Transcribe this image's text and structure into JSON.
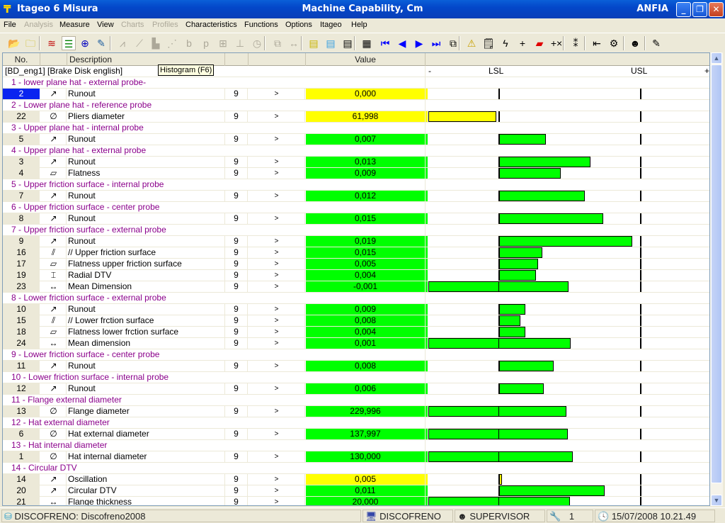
{
  "window": {
    "app_title": "Itageo 6 Misura",
    "doc_title": "Machine Capability, Cm",
    "company": "ANFIA",
    "buttons": {
      "minimize": "_",
      "restore": "❐",
      "close": "✕"
    }
  },
  "menu": [
    {
      "label": "File",
      "enabled": true
    },
    {
      "label": "Analysis",
      "enabled": false
    },
    {
      "label": "Measure",
      "enabled": true
    },
    {
      "label": "View",
      "enabled": true
    },
    {
      "label": "Charts",
      "enabled": false
    },
    {
      "label": "Profiles",
      "enabled": false
    },
    {
      "label": "Characteristics",
      "enabled": true
    },
    {
      "label": "Functions",
      "enabled": true
    },
    {
      "label": "Options",
      "enabled": true
    },
    {
      "label": "Itageo",
      "enabled": true
    },
    {
      "label": "Help",
      "enabled": true
    }
  ],
  "toolbar": [
    {
      "icon": "open-folder-icon",
      "glyph": "📂"
    },
    {
      "icon": "folder-icon",
      "glyph": "🗀"
    },
    {
      "icon": "chart-list-icon",
      "glyph": "≋"
    },
    {
      "icon": "histogram-view-icon",
      "glyph": "☰",
      "pressed": true
    },
    {
      "icon": "crosshair-icon",
      "glyph": "⊕"
    },
    {
      "icon": "pen-icon",
      "glyph": "✎"
    },
    {
      "icon": "run-chart-icon",
      "glyph": "⩘",
      "disabled": true
    },
    {
      "icon": "regression-icon",
      "glyph": "⟋",
      "disabled": true
    },
    {
      "icon": "bar-chart-icon",
      "glyph": "▙",
      "disabled": true
    },
    {
      "icon": "scatter-icon",
      "glyph": "⋰",
      "disabled": true
    },
    {
      "icon": "b-chart-icon",
      "glyph": "b",
      "disabled": true
    },
    {
      "icon": "p-chart-icon",
      "glyph": "p",
      "disabled": true
    },
    {
      "icon": "control-chart-icon",
      "glyph": "⊞",
      "disabled": true
    },
    {
      "icon": "boxplot-icon",
      "glyph": "⊥",
      "disabled": true
    },
    {
      "icon": "clock-chart-icon",
      "glyph": "◷",
      "disabled": true
    },
    {
      "icon": "copy-chart-icon",
      "glyph": "⧉",
      "disabled": true
    },
    {
      "icon": "range-icon",
      "glyph": "↔",
      "disabled": true
    },
    {
      "icon": "note-yellow-icon",
      "glyph": "▤"
    },
    {
      "icon": "note-blue-icon",
      "glyph": "▤"
    },
    {
      "icon": "note-white-icon",
      "glyph": "▤"
    },
    {
      "icon": "open-table-icon",
      "glyph": "▦"
    },
    {
      "icon": "first-record-icon",
      "glyph": "⏮"
    },
    {
      "icon": "previous-record-icon",
      "glyph": "◀"
    },
    {
      "icon": "next-record-icon",
      "glyph": "▶"
    },
    {
      "icon": "last-record-icon",
      "glyph": "⏭"
    },
    {
      "icon": "pages-icon",
      "glyph": "⧉"
    },
    {
      "icon": "warning-icon",
      "glyph": "⚠"
    },
    {
      "icon": "notepad-icon",
      "glyph": "🗒"
    },
    {
      "icon": "flash-list-icon",
      "glyph": "ϟ"
    },
    {
      "icon": "plus-cross-icon",
      "glyph": "+"
    },
    {
      "icon": "red-bookmark-icon",
      "glyph": "▰"
    },
    {
      "icon": "plus-times-icon",
      "glyph": "+×"
    },
    {
      "icon": "numbering-icon",
      "glyph": "⁑"
    },
    {
      "icon": "align-icon",
      "glyph": "⇤"
    },
    {
      "icon": "settings-tools-icon",
      "glyph": "⚙"
    },
    {
      "icon": "operator-icon",
      "glyph": "☻"
    },
    {
      "icon": "properties-icon",
      "glyph": "✎"
    }
  ],
  "tooltip": "Histogram (F6)",
  "grid": {
    "headers": {
      "no": "No.",
      "symbol": "",
      "description": "Description",
      "n": "",
      "op": "",
      "value": "Value"
    },
    "part_title": "[BD_eng1] [Brake Disk english]",
    "scale": {
      "minus": "-",
      "lsl": "LSL",
      "usl": "USL",
      "plus": "+"
    },
    "colors": {
      "ok": "#00ff00",
      "warning": "#ffff00",
      "selected": "#0a24f0",
      "group": "#8b008b"
    },
    "rows": [
      {
        "type": "group",
        "label": "1 - lower plane hat - external probe-"
      },
      {
        "type": "item",
        "no": "2",
        "symbol": "↗",
        "symbol_name": "runout-icon",
        "desc": "Runout",
        "n": "9",
        "op": ">",
        "value": "0,000",
        "status": "warning",
        "selected": true,
        "bar": null
      },
      {
        "type": "group",
        "label": "2 - Lower plane hat - reference probe"
      },
      {
        "type": "item",
        "no": "22",
        "symbol": "∅",
        "symbol_name": "diameter-icon",
        "desc": "Pliers diameter",
        "n": "9",
        "op": ">",
        "value": "61,998",
        "status": "warning",
        "bar": [
          -0.5,
          -0.02
        ]
      },
      {
        "type": "group",
        "label": "3 - Upper plane hat - internal probe"
      },
      {
        "type": "item",
        "no": "5",
        "symbol": "↗",
        "symbol_name": "runout-icon",
        "desc": "Runout",
        "n": "9",
        "op": ">",
        "value": "0,007",
        "status": "ok",
        "bar": [
          0,
          0.33
        ]
      },
      {
        "type": "group",
        "label": "4 - Upper plane hat - external probe"
      },
      {
        "type": "item",
        "no": "3",
        "symbol": "↗",
        "symbol_name": "runout-icon",
        "desc": "Runout",
        "n": "9",
        "op": ">",
        "value": "0,013",
        "status": "ok",
        "bar": [
          0,
          0.645
        ]
      },
      {
        "type": "item",
        "no": "4",
        "symbol": "▱",
        "symbol_name": "flatness-icon",
        "desc": "Flatness",
        "n": "9",
        "op": ">",
        "value": "0,009",
        "status": "ok",
        "bar": [
          0,
          0.435
        ]
      },
      {
        "type": "group",
        "label": "5 - Upper friction surface - internal probe"
      },
      {
        "type": "item",
        "no": "7",
        "symbol": "↗",
        "symbol_name": "runout-icon",
        "desc": "Runout",
        "n": "9",
        "op": ">",
        "value": "0,012",
        "status": "ok",
        "bar": [
          0,
          0.605
        ]
      },
      {
        "type": "group",
        "label": "6 - Upper friction surface - center probe"
      },
      {
        "type": "item",
        "no": "8",
        "symbol": "↗",
        "symbol_name": "runout-icon",
        "desc": "Runout",
        "n": "9",
        "op": ">",
        "value": "0,015",
        "status": "ok",
        "bar": [
          0,
          0.735
        ]
      },
      {
        "type": "group",
        "label": "7 - Upper friction surface - external probe"
      },
      {
        "type": "item",
        "no": "9",
        "symbol": "↗",
        "symbol_name": "runout-icon",
        "desc": "Runout",
        "n": "9",
        "op": ">",
        "value": "0,019",
        "status": "ok",
        "bar": [
          0,
          0.94
        ]
      },
      {
        "type": "item",
        "no": "16",
        "symbol": "⫽",
        "symbol_name": "parallelism-icon",
        "desc": "// Upper friction surface",
        "n": "9",
        "op": ">",
        "value": "0,015",
        "status": "ok",
        "bar": [
          0,
          0.305
        ]
      },
      {
        "type": "item",
        "no": "17",
        "symbol": "▱",
        "symbol_name": "flatness-icon",
        "desc": "Flatness upper friction surface",
        "n": "9",
        "op": ">",
        "value": "0,005",
        "status": "ok",
        "bar": [
          0,
          0.275
        ]
      },
      {
        "type": "item",
        "no": "19",
        "symbol": "⌶",
        "symbol_name": "thickness-variation-icon",
        "desc": "Radial DTV",
        "n": "9",
        "op": ">",
        "value": "0,004",
        "status": "ok",
        "bar": [
          0,
          0.26
        ]
      },
      {
        "type": "item",
        "no": "23",
        "symbol": "↔",
        "symbol_name": "dimension-icon",
        "desc": "Mean Dimension",
        "n": "9",
        "op": ">",
        "value": "-0,001",
        "status": "ok",
        "bar": [
          -0.5,
          0.49
        ]
      },
      {
        "type": "group",
        "label": "8 - Lower friction surface - external probe"
      },
      {
        "type": "item",
        "no": "10",
        "symbol": "↗",
        "symbol_name": "runout-icon",
        "desc": "Runout",
        "n": "9",
        "op": ">",
        "value": "0,009",
        "status": "ok",
        "bar": [
          0,
          0.185
        ]
      },
      {
        "type": "item",
        "no": "15",
        "symbol": "⫽",
        "symbol_name": "parallelism-icon",
        "desc": "// Lower frction surface",
        "n": "9",
        "op": ">",
        "value": "0,008",
        "status": "ok",
        "bar": [
          0,
          0.15
        ]
      },
      {
        "type": "item",
        "no": "18",
        "symbol": "▱",
        "symbol_name": "flatness-icon",
        "desc": "Flatness lower frction surface",
        "n": "9",
        "op": ">",
        "value": "0,004",
        "status": "ok",
        "bar": [
          0,
          0.185
        ]
      },
      {
        "type": "item",
        "no": "24",
        "symbol": "↔",
        "symbol_name": "dimension-icon",
        "desc": "Mean dimension",
        "n": "9",
        "op": ">",
        "value": "0,001",
        "status": "ok",
        "bar": [
          -0.5,
          0.505
        ]
      },
      {
        "type": "group",
        "label": "9 - Lower friction surface - center probe"
      },
      {
        "type": "item",
        "no": "11",
        "symbol": "↗",
        "symbol_name": "runout-icon",
        "desc": "Runout",
        "n": "9",
        "op": ">",
        "value": "0,008",
        "status": "ok",
        "bar": [
          0,
          0.385
        ]
      },
      {
        "type": "group",
        "label": "10 - Lower friction surface - internal probe"
      },
      {
        "type": "item",
        "no": "12",
        "symbol": "↗",
        "symbol_name": "runout-icon",
        "desc": "Runout",
        "n": "9",
        "op": ">",
        "value": "0,006",
        "status": "ok",
        "bar": [
          0,
          0.315
        ]
      },
      {
        "type": "group",
        "label": "11 - Flange external diameter"
      },
      {
        "type": "item",
        "no": "13",
        "symbol": "∅",
        "symbol_name": "diameter-icon",
        "desc": "Flange diameter",
        "n": "9",
        "op": ">",
        "value": "229,996",
        "status": "ok",
        "bar": [
          -0.5,
          0.475
        ]
      },
      {
        "type": "group",
        "label": "12 - Hat external diameter"
      },
      {
        "type": "item",
        "no": "6",
        "symbol": "∅",
        "symbol_name": "diameter-icon",
        "desc": "Hat external diameter",
        "n": "9",
        "op": ">",
        "value": "137,997",
        "status": "ok",
        "bar": [
          -0.5,
          0.485
        ]
      },
      {
        "type": "group",
        "label": "13 - Hat internal diameter"
      },
      {
        "type": "item",
        "no": "1",
        "symbol": "∅",
        "symbol_name": "diameter-icon",
        "desc": "Hat internal diameter",
        "n": "9",
        "op": ">",
        "value": "130,000",
        "status": "ok",
        "bar": [
          -0.5,
          0.52
        ]
      },
      {
        "type": "group",
        "label": "14 - Circular DTV"
      },
      {
        "type": "item",
        "no": "14",
        "symbol": "↗",
        "symbol_name": "runout-icon",
        "desc": "Oscillation",
        "n": "9",
        "op": ">",
        "value": "0,005",
        "status": "warning",
        "bar": [
          0,
          0.02
        ]
      },
      {
        "type": "item",
        "no": "20",
        "symbol": "↗",
        "symbol_name": "runout-icon",
        "desc": "Circular DTV",
        "n": "9",
        "op": ">",
        "value": "0,011",
        "status": "ok",
        "bar": [
          0,
          0.745
        ]
      },
      {
        "type": "item",
        "no": "21",
        "symbol": "↔",
        "symbol_name": "dimension-icon",
        "desc": "Flange thickness",
        "n": "9",
        "op": ">",
        "value": "20,000",
        "status": "ok",
        "bar": [
          -0.5,
          0.5
        ]
      }
    ]
  },
  "statusbar": {
    "database": "DISCOFRENO: Discofreno2008",
    "station": "DISCOFRENO",
    "user": "SUPERVISOR",
    "level": "1",
    "datetime": "15/07/2008 10.21.49"
  }
}
